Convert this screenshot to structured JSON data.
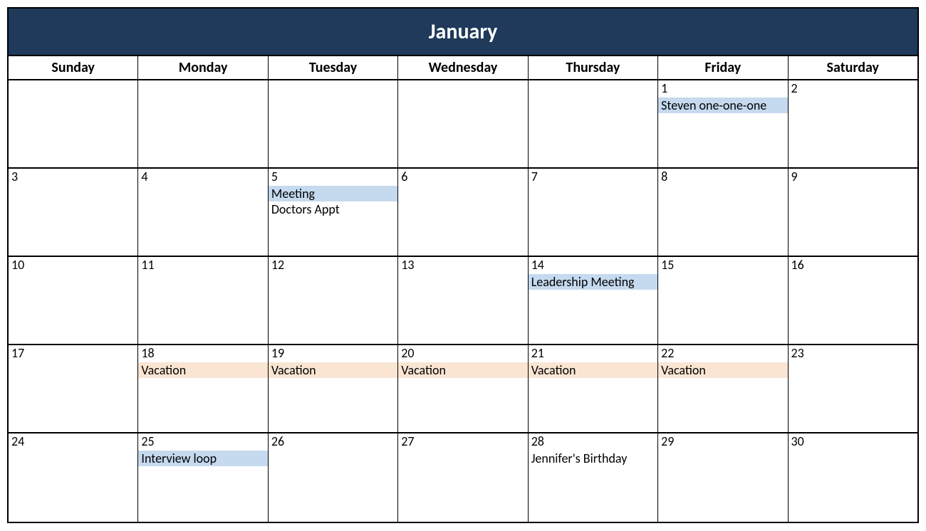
{
  "title": "January",
  "days_header": [
    "Sunday",
    "Monday",
    "Tuesday",
    "Wednesday",
    "Thursday",
    "Friday",
    "Saturday"
  ],
  "weeks": [
    [
      {
        "num": "",
        "events": []
      },
      {
        "num": "",
        "events": []
      },
      {
        "num": "",
        "events": []
      },
      {
        "num": "",
        "events": []
      },
      {
        "num": "",
        "events": []
      },
      {
        "num": "1",
        "events": [
          {
            "text": "Steven one-one-one",
            "hl": "blue"
          }
        ]
      },
      {
        "num": "2",
        "events": []
      }
    ],
    [
      {
        "num": "3",
        "events": []
      },
      {
        "num": "4",
        "events": []
      },
      {
        "num": "5",
        "events": [
          {
            "text": "Meeting",
            "hl": "blue"
          },
          {
            "text": "Doctors Appt",
            "hl": ""
          }
        ]
      },
      {
        "num": "6",
        "events": []
      },
      {
        "num": "7",
        "events": []
      },
      {
        "num": "8",
        "events": []
      },
      {
        "num": "9",
        "events": []
      }
    ],
    [
      {
        "num": "10",
        "events": []
      },
      {
        "num": "11",
        "events": []
      },
      {
        "num": "12",
        "events": []
      },
      {
        "num": "13",
        "events": []
      },
      {
        "num": "14",
        "events": [
          {
            "text": "Leadership Meeting",
            "hl": "blue"
          }
        ]
      },
      {
        "num": "15",
        "events": []
      },
      {
        "num": "16",
        "events": []
      }
    ],
    [
      {
        "num": "17",
        "events": []
      },
      {
        "num": "18",
        "events": [
          {
            "text": "Vacation",
            "hl": "orange"
          }
        ]
      },
      {
        "num": "19",
        "events": [
          {
            "text": "Vacation",
            "hl": "orange"
          }
        ]
      },
      {
        "num": "20",
        "events": [
          {
            "text": "Vacation",
            "hl": "orange"
          }
        ]
      },
      {
        "num": "21",
        "events": [
          {
            "text": "Vacation",
            "hl": "orange"
          }
        ]
      },
      {
        "num": "22",
        "events": [
          {
            "text": "Vacation",
            "hl": "orange"
          }
        ]
      },
      {
        "num": "23",
        "events": []
      }
    ],
    [
      {
        "num": "24",
        "events": []
      },
      {
        "num": "25",
        "events": [
          {
            "text": "Interview loop",
            "hl": "blue"
          }
        ]
      },
      {
        "num": "26",
        "events": []
      },
      {
        "num": "27",
        "events": []
      },
      {
        "num": "28",
        "events": [
          {
            "text": "Jennifer's Birthday",
            "hl": ""
          }
        ]
      },
      {
        "num": "29",
        "events": []
      },
      {
        "num": "30",
        "events": []
      }
    ]
  ]
}
